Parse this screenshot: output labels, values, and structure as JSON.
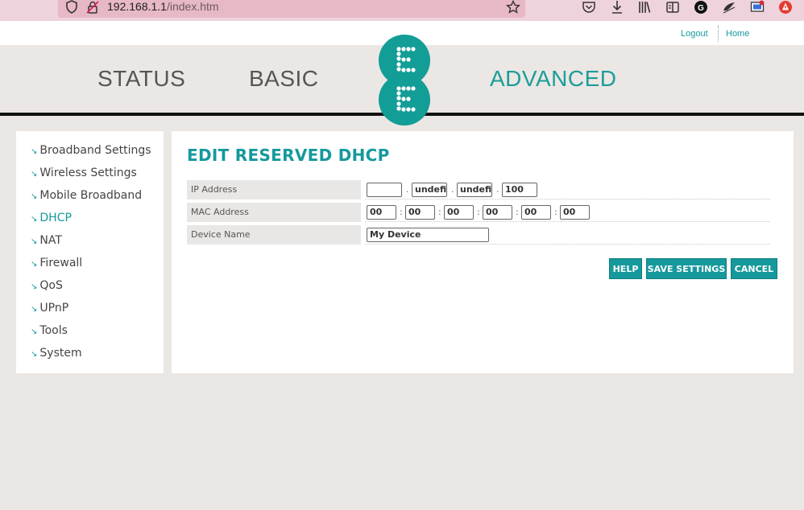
{
  "browser": {
    "url_host": "192.168.1.1",
    "url_path": "/index.htm"
  },
  "top_links": {
    "logout": "Logout",
    "home": "Home"
  },
  "nav": {
    "status": "STATUS",
    "basic": "BASIC",
    "advanced": "ADVANCED",
    "logo_letters": [
      "E",
      "E"
    ]
  },
  "sidebar": {
    "items": [
      {
        "label": "Broadband Settings"
      },
      {
        "label": "Wireless Settings"
      },
      {
        "label": "Mobile Broadband"
      },
      {
        "label": "DHCP"
      },
      {
        "label": "NAT"
      },
      {
        "label": "Firewall"
      },
      {
        "label": "QoS"
      },
      {
        "label": "UPnP"
      },
      {
        "label": "Tools"
      },
      {
        "label": "System"
      }
    ],
    "active": "DHCP"
  },
  "form": {
    "title": "EDIT RESERVED DHCP",
    "ip_label": "IP Address",
    "ip": [
      "",
      "undefi",
      "undefi",
      "100"
    ],
    "mac_label": "MAC Address",
    "mac": [
      "00",
      "00",
      "00",
      "00",
      "00",
      "00"
    ],
    "device_label": "Device Name",
    "device_name": "My Device",
    "ip_sep": ".",
    "mac_sep": ":"
  },
  "buttons": {
    "help": "HELP",
    "save": "SAVE SETTINGS",
    "cancel": "CANCEL"
  },
  "colors": {
    "accent": "#15999c",
    "browser_bar": "#efd3dc",
    "background": "#ebe7e4"
  }
}
